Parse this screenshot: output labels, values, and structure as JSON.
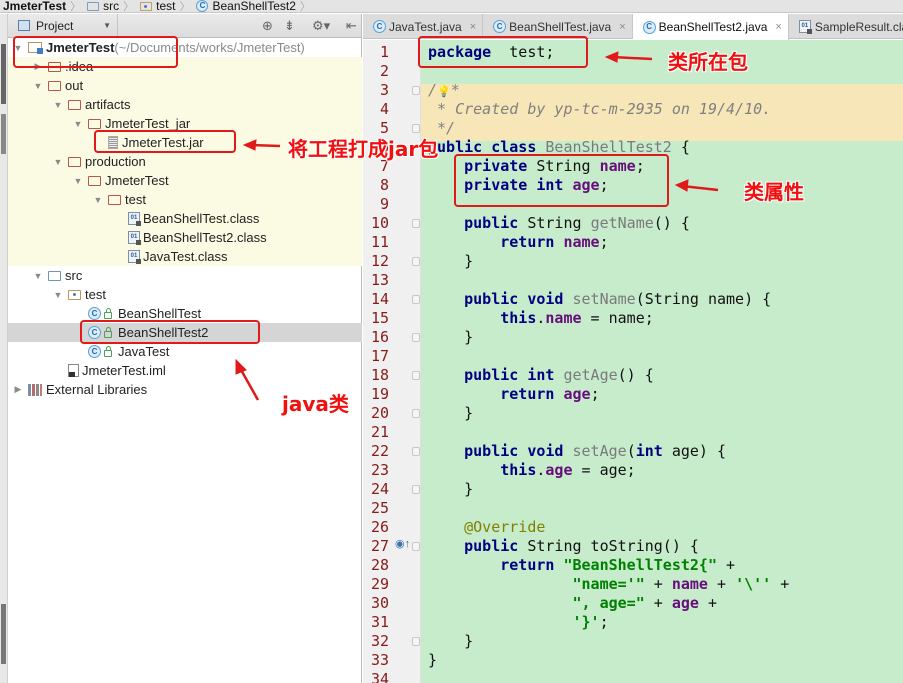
{
  "breadcrumb": [
    {
      "label": "JmeterTest",
      "icon": "module-folder-icon"
    },
    {
      "label": "src",
      "icon": "source-folder-icon"
    },
    {
      "label": "test",
      "icon": "package-icon"
    },
    {
      "label": "BeanShellTest2",
      "icon": "class-icon"
    }
  ],
  "project_panel": {
    "title": "Project",
    "toolbar": [
      "locate-icon",
      "collapse-icon",
      "gear-icon",
      "hide-icon"
    ],
    "tree": [
      {
        "label": "JmeterTest",
        "suffix": " (~/Documents/works/JmeterTest)",
        "icon": "module",
        "arrow": "▼",
        "level": 0,
        "bold": true
      },
      {
        "label": ".idea",
        "icon": "folder-red",
        "arrow": "▶",
        "level": 1
      },
      {
        "label": "out",
        "icon": "folder-red",
        "arrow": "▼",
        "level": 1
      },
      {
        "label": "artifacts",
        "icon": "folder-red",
        "arrow": "▼",
        "level": 2
      },
      {
        "label": "JmeterTest_jar",
        "icon": "folder-red",
        "arrow": "▼",
        "level": 3
      },
      {
        "label": "JmeterTest.jar",
        "icon": "jar",
        "arrow": "",
        "level": 4
      },
      {
        "label": "production",
        "icon": "folder-red",
        "arrow": "▼",
        "level": 2
      },
      {
        "label": "JmeterTest",
        "icon": "folder-red",
        "arrow": "▼",
        "level": 3
      },
      {
        "label": "test",
        "icon": "folder-red",
        "arrow": "▼",
        "level": 4
      },
      {
        "label": "BeanShellTest.class",
        "icon": "classfile",
        "arrow": "",
        "level": 5
      },
      {
        "label": "BeanShellTest2.class",
        "icon": "classfile",
        "arrow": "",
        "level": 5
      },
      {
        "label": "JavaTest.class",
        "icon": "classfile",
        "arrow": "",
        "level": 5
      },
      {
        "label": "src",
        "icon": "folder-blue",
        "arrow": "▼",
        "level": 1
      },
      {
        "label": "test",
        "icon": "package",
        "arrow": "▼",
        "level": 2
      },
      {
        "label": "BeanShellTest",
        "icon": "class",
        "arrow": "",
        "level": 3
      },
      {
        "label": "BeanShellTest2",
        "icon": "class",
        "arrow": "",
        "level": 3,
        "selected": true
      },
      {
        "label": "JavaTest",
        "icon": "class",
        "arrow": "",
        "level": 3
      },
      {
        "label": "JmeterTest.iml",
        "icon": "iml",
        "arrow": "",
        "level": 2
      },
      {
        "label": "External Libraries",
        "icon": "lib",
        "arrow": "▶",
        "level": 0
      }
    ]
  },
  "editor_tabs": [
    {
      "label": "JavaTest.java",
      "icon": "class",
      "closable": true
    },
    {
      "label": "BeanShellTest.java",
      "icon": "class",
      "closable": true
    },
    {
      "label": "BeanShellTest2.java",
      "icon": "class",
      "closable": true,
      "active": true
    },
    {
      "label": "SampleResult.class",
      "icon": "classfile",
      "closable": false
    }
  ],
  "close_glyph": "×",
  "code_lines": [
    [
      [
        "kw",
        "package"
      ],
      [
        "",
        "  test;"
      ]
    ],
    [],
    [
      [
        "cmt",
        "/"
      ],
      [
        "bulb",
        ""
      ],
      [
        "cmt",
        "*"
      ]
    ],
    [
      [
        "cmt",
        " * Created by yp-tc-m-2935 on 19/4/10."
      ]
    ],
    [
      [
        "cmt",
        " */"
      ]
    ],
    [
      [
        "kw",
        "public class "
      ],
      [
        "mth",
        "BeanShellTest2"
      ],
      [
        "",
        " {"
      ]
    ],
    [
      [
        "",
        "    "
      ],
      [
        "kw",
        "private "
      ],
      [
        "",
        "String "
      ],
      [
        "fld",
        "name"
      ],
      [
        "",
        ";"
      ]
    ],
    [
      [
        "",
        "    "
      ],
      [
        "kw",
        "private int "
      ],
      [
        "fld",
        "age"
      ],
      [
        "",
        ";"
      ]
    ],
    [],
    [
      [
        "",
        "    "
      ],
      [
        "kw",
        "public "
      ],
      [
        "",
        "String "
      ],
      [
        "mth",
        "getName"
      ],
      [
        "",
        "() {"
      ]
    ],
    [
      [
        "",
        "        "
      ],
      [
        "kw",
        "return "
      ],
      [
        "fld",
        "name"
      ],
      [
        "",
        ";"
      ]
    ],
    [
      [
        "",
        "    }"
      ]
    ],
    [],
    [
      [
        "",
        "    "
      ],
      [
        "kw",
        "public void "
      ],
      [
        "mth",
        "setName"
      ],
      [
        "",
        "(String name) {"
      ]
    ],
    [
      [
        "",
        "        "
      ],
      [
        "kw",
        "this"
      ],
      [
        "",
        "."
      ],
      [
        "fld",
        "name"
      ],
      [
        "",
        " = name;"
      ]
    ],
    [
      [
        "",
        "    }"
      ]
    ],
    [],
    [
      [
        "",
        "    "
      ],
      [
        "kw",
        "public int "
      ],
      [
        "mth",
        "getAge"
      ],
      [
        "",
        "() {"
      ]
    ],
    [
      [
        "",
        "        "
      ],
      [
        "kw",
        "return "
      ],
      [
        "fld",
        "age"
      ],
      [
        "",
        ";"
      ]
    ],
    [
      [
        "",
        "    }"
      ]
    ],
    [],
    [
      [
        "",
        "    "
      ],
      [
        "kw",
        "public void "
      ],
      [
        "mth",
        "setAge"
      ],
      [
        "",
        "("
      ],
      [
        "kw",
        "int"
      ],
      [
        "",
        " age) {"
      ]
    ],
    [
      [
        "",
        "        "
      ],
      [
        "kw",
        "this"
      ],
      [
        "",
        "."
      ],
      [
        "fld",
        "age"
      ],
      [
        "",
        " = age;"
      ]
    ],
    [
      [
        "",
        "    }"
      ]
    ],
    [],
    [
      [
        "",
        "    "
      ],
      [
        "ann",
        "@Override"
      ]
    ],
    [
      [
        "",
        "    "
      ],
      [
        "kw",
        "public "
      ],
      [
        "",
        "String toString() {"
      ]
    ],
    [
      [
        "",
        "        "
      ],
      [
        "kw",
        "return "
      ],
      [
        "str",
        "\"BeanShellTest2{\""
      ],
      [
        "",
        " +"
      ]
    ],
    [
      [
        "",
        "                "
      ],
      [
        "str",
        "\"name='\""
      ],
      [
        "",
        " + "
      ],
      [
        "fld",
        "name"
      ],
      [
        "",
        " + "
      ],
      [
        "str",
        "'\\''"
      ],
      [
        "",
        " +"
      ]
    ],
    [
      [
        "",
        "                "
      ],
      [
        "str",
        "\", age=\""
      ],
      [
        "",
        " + "
      ],
      [
        "fld",
        "age"
      ],
      [
        "",
        " +"
      ]
    ],
    [
      [
        "",
        "                "
      ],
      [
        "str",
        "'}'"
      ],
      [
        "",
        ";"
      ]
    ],
    [
      [
        "",
        "    }"
      ]
    ],
    [
      [
        "",
        "}"
      ]
    ],
    []
  ],
  "annotations": {
    "package_label": "类所在包",
    "jar_label": "将工程打成jar包",
    "fields_label": "类属性",
    "class_label": "java类"
  },
  "colors": {
    "annotation_red": "#e01a1a",
    "editor_bg": "#c7eccc",
    "comment_band": "#f7e7b8",
    "tree_yellow": "#fbfbe4"
  }
}
